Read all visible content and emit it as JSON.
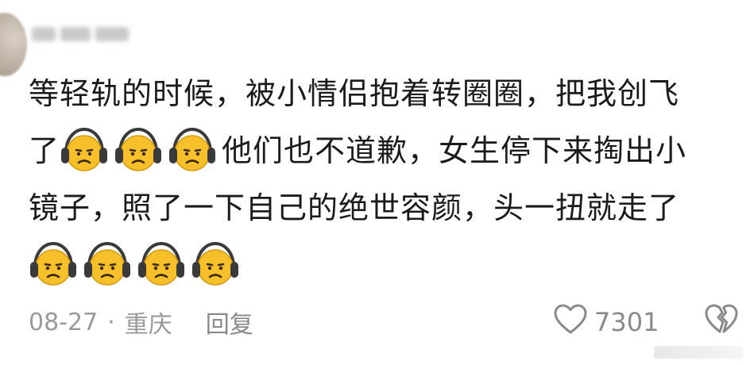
{
  "comment": {
    "lines": [
      [
        {
          "type": "text",
          "value": "等轻轨的时候，被小情侣抱着转圈圈，把我创飞"
        }
      ],
      [
        {
          "type": "text",
          "value": "了"
        },
        {
          "type": "emoji",
          "icon": "frowning-face-headphones-icon"
        },
        {
          "type": "emoji",
          "icon": "frowning-face-headphones-icon"
        },
        {
          "type": "emoji",
          "icon": "frowning-face-headphones-icon"
        },
        {
          "type": "text",
          "value": "他们也不道歉，女生停下来掏出小"
        }
      ],
      [
        {
          "type": "text",
          "value": "镜子，照了一下自己的绝世容颜，头一扭就走了"
        }
      ],
      [
        {
          "type": "emoji",
          "icon": "frowning-face-headphones-icon"
        },
        {
          "type": "emoji",
          "icon": "frowning-face-headphones-icon"
        },
        {
          "type": "emoji",
          "icon": "frowning-face-headphones-icon"
        },
        {
          "type": "emoji",
          "icon": "frowning-face-headphones-icon"
        }
      ]
    ]
  },
  "footer": {
    "date": "08-27",
    "separator": "·",
    "location": "重庆",
    "reply_label": "回复",
    "like_count": "7301",
    "like_icon": "heart-outline-icon",
    "dislike_icon": "broken-heart-icon"
  },
  "colors": {
    "text": "#1b1b1b",
    "meta": "#9a9a9a",
    "emoji_face": "#f7c02a",
    "emoji_headphones": "#3a3a3a"
  }
}
